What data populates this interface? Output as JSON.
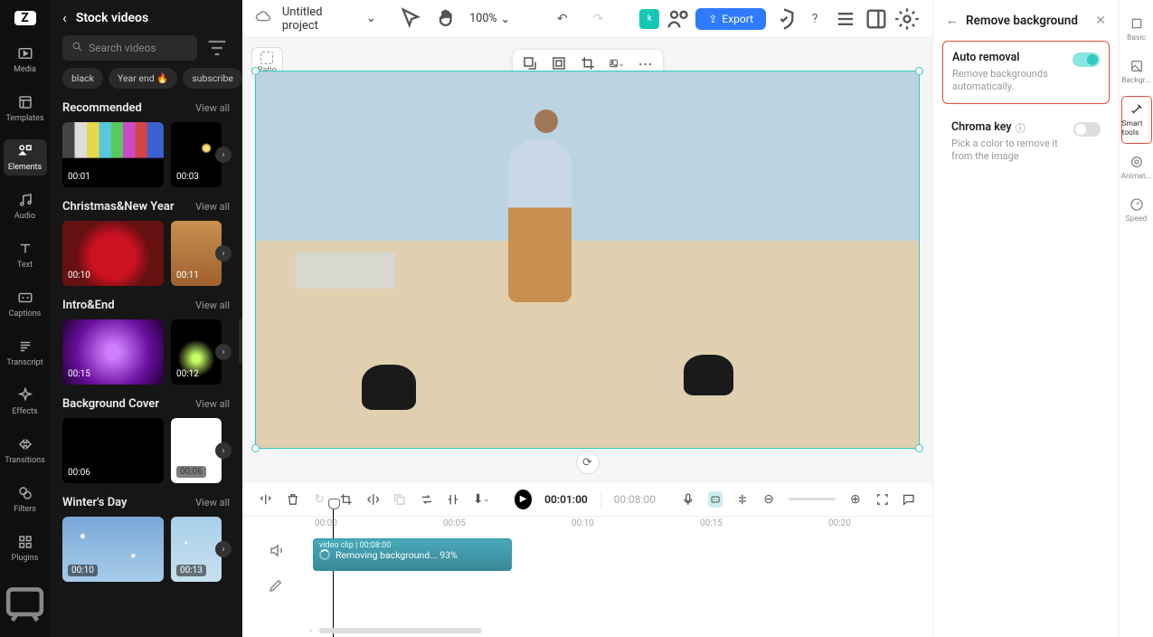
{
  "rail": {
    "items": [
      {
        "id": "media",
        "label": "Media"
      },
      {
        "id": "templates",
        "label": "Templates"
      },
      {
        "id": "elements",
        "label": "Elements"
      },
      {
        "id": "audio",
        "label": "Audio"
      },
      {
        "id": "text",
        "label": "Text"
      },
      {
        "id": "captions",
        "label": "Captions"
      },
      {
        "id": "transcript",
        "label": "Transcript"
      },
      {
        "id": "effects",
        "label": "Effects"
      },
      {
        "id": "transitions",
        "label": "Transitions"
      },
      {
        "id": "filters",
        "label": "Filters"
      },
      {
        "id": "plugins",
        "label": "Plugins"
      }
    ]
  },
  "stock": {
    "title": "Stock videos",
    "search_placeholder": "Search videos",
    "tags": [
      "black",
      "Year end 🔥",
      "subscribe"
    ],
    "viewall": "View all",
    "sections": [
      {
        "title": "Recommended",
        "thumbs": [
          {
            "dur": "00:01"
          },
          {
            "dur": "00:03"
          }
        ]
      },
      {
        "title": "Christmas&New Year",
        "thumbs": [
          {
            "dur": "00:10"
          },
          {
            "dur": "00:11"
          }
        ]
      },
      {
        "title": "Intro&End",
        "thumbs": [
          {
            "dur": "00:15"
          },
          {
            "dur": "00:12"
          }
        ]
      },
      {
        "title": "Background Cover",
        "thumbs": [
          {
            "dur": "00:06"
          },
          {
            "dur": "00:06"
          }
        ]
      },
      {
        "title": "Winter's Day",
        "thumbs": [
          {
            "dur": "00:10"
          },
          {
            "dur": "00:13"
          }
        ]
      }
    ]
  },
  "topbar": {
    "project_title": "Untitled project",
    "zoom": "100%",
    "export": "Export"
  },
  "canvas": {
    "ratio_label": "Ratio"
  },
  "timeline": {
    "current": "00:01:00",
    "total": "00:08:00",
    "ruler": [
      "00:00",
      "00:05",
      "00:10",
      "00:15",
      "00:20"
    ],
    "clip": {
      "label": "video clip",
      "clip_dur": "00:08:00",
      "status": "Removing background...",
      "progress": "93%"
    }
  },
  "props": {
    "title": "Remove background",
    "auto": {
      "title": "Auto removal",
      "desc": "Remove backgrounds automatically."
    },
    "chroma": {
      "title": "Chroma key",
      "desc": "Pick a color to remove it from the image"
    }
  },
  "prop_rail": {
    "items": [
      {
        "id": "basic",
        "label": "Basic"
      },
      {
        "id": "background",
        "label": "Backgr..."
      },
      {
        "id": "smart",
        "label": "Smart tools"
      },
      {
        "id": "animation",
        "label": "Animat..."
      },
      {
        "id": "speed",
        "label": "Speed"
      }
    ]
  }
}
